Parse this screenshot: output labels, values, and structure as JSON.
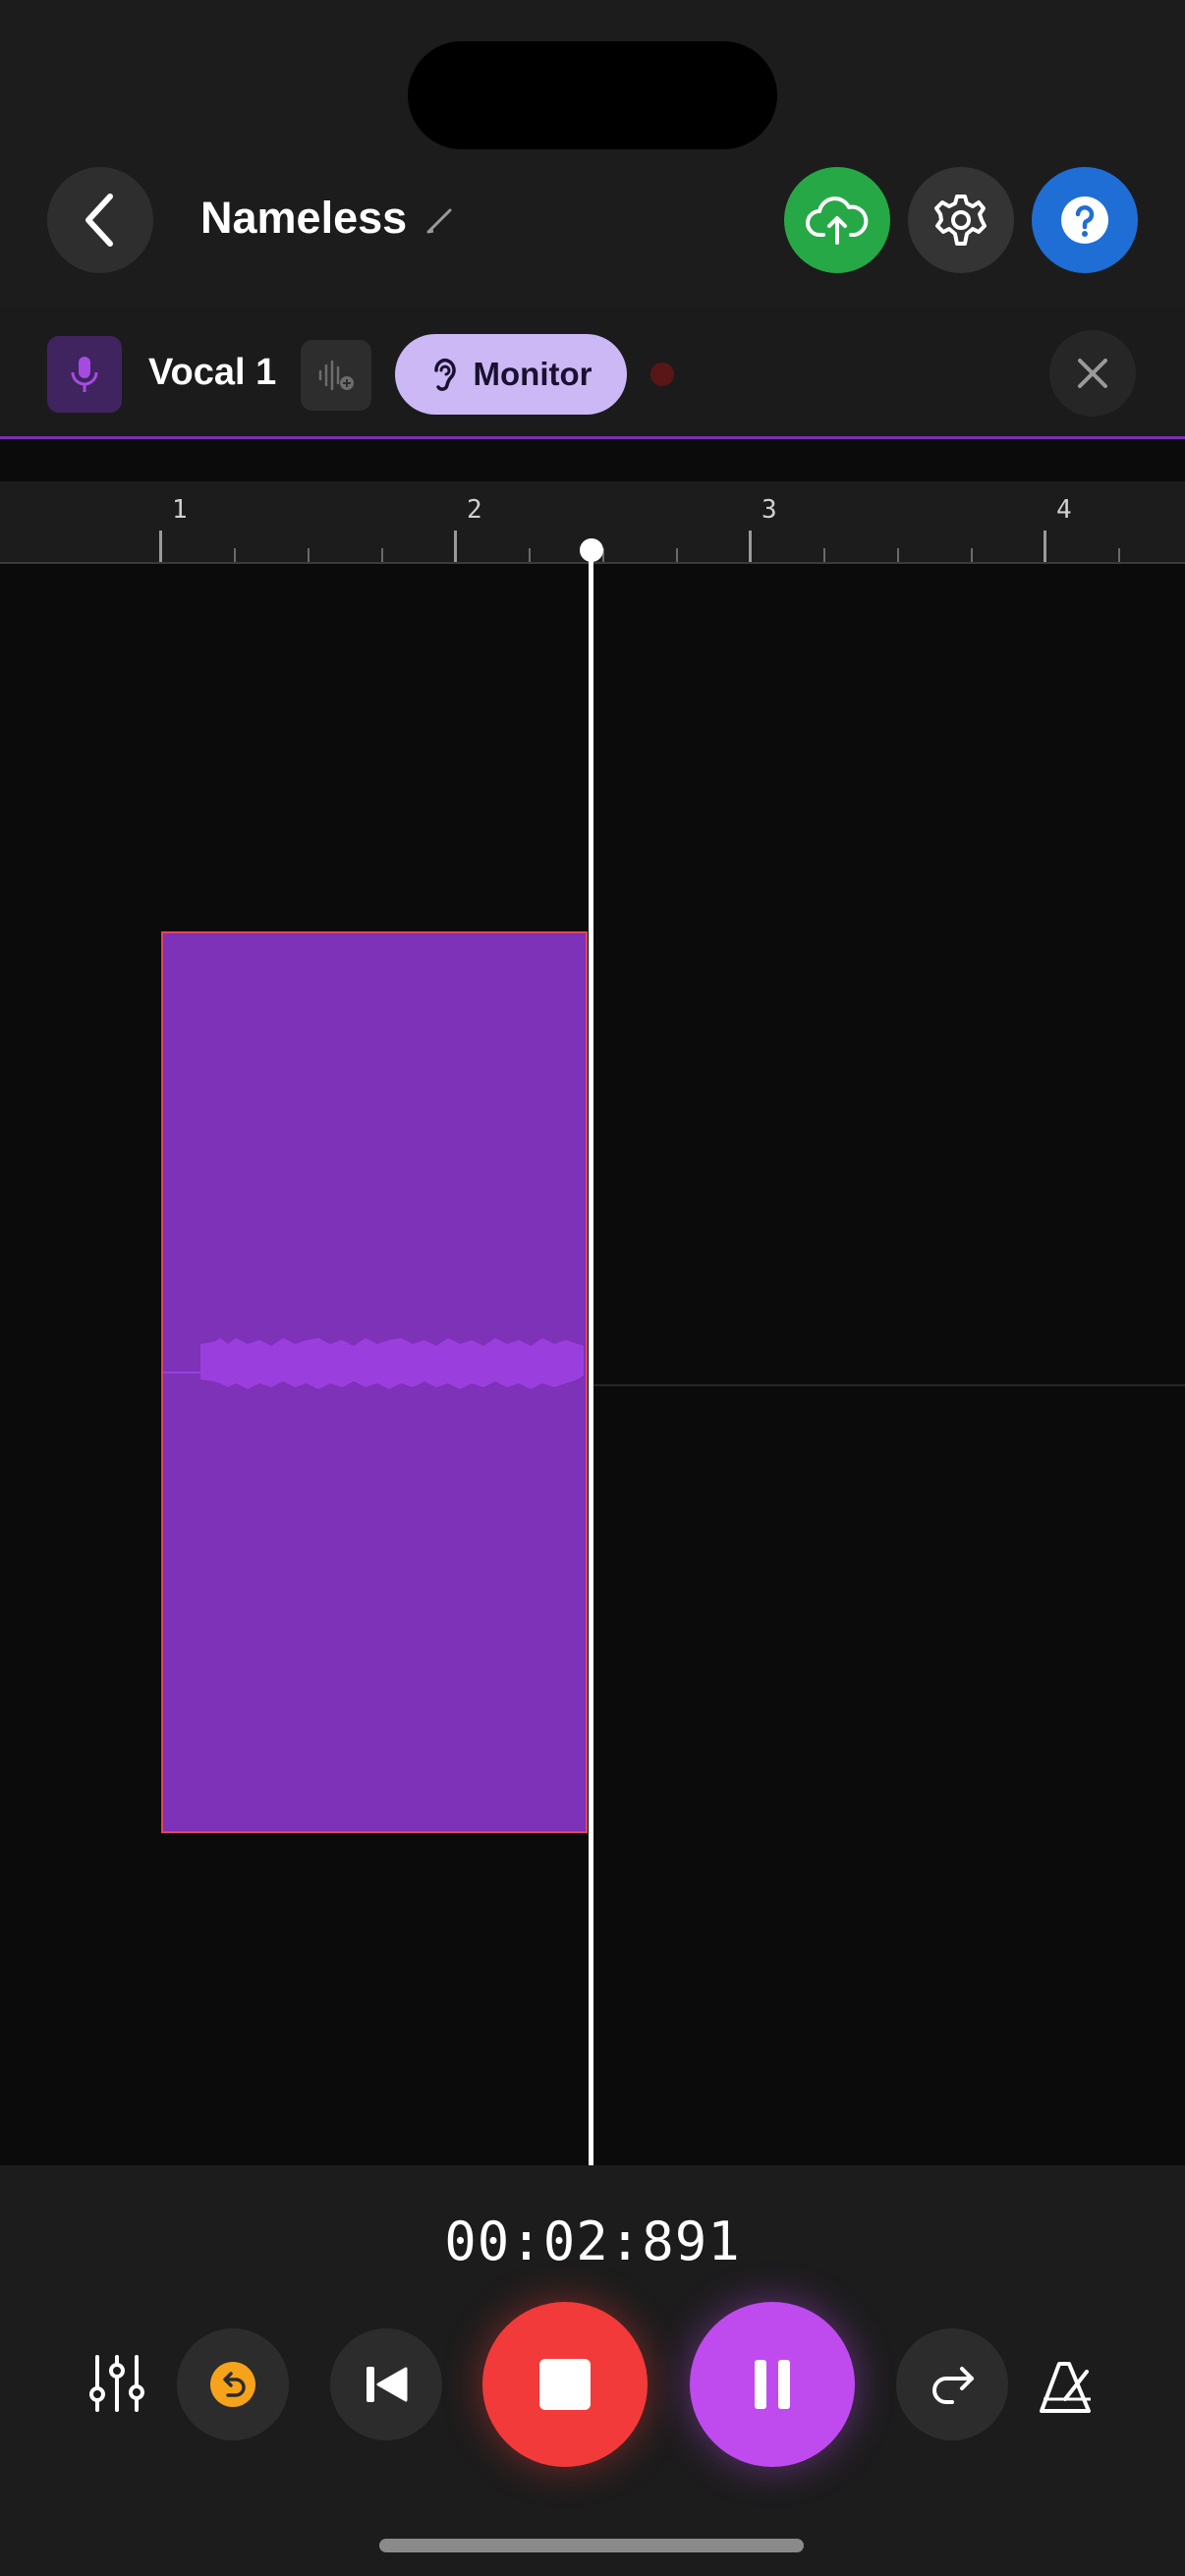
{
  "header": {
    "title": "Nameless",
    "back_icon": "chevron-left-icon",
    "edit_icon": "pencil-icon",
    "upload_icon": "cloud-upload-icon",
    "settings_icon": "gear-icon",
    "help_icon": "question-icon"
  },
  "track": {
    "name": "Vocal 1",
    "monitor_label": "Monitor",
    "icons": [
      "microphone-icon",
      "waveform-add-icon",
      "ear-icon",
      "close-icon"
    ]
  },
  "ruler": {
    "bars": [
      "1",
      "2",
      "3",
      "4"
    ]
  },
  "transport": {
    "timecode": "00:02:891",
    "icons": [
      "mixer-icon",
      "undo-icon",
      "rewind-icon",
      "stop-icon",
      "pause-icon",
      "redo-icon",
      "metronome-icon"
    ]
  },
  "colors": {
    "clip": "#7d32b8",
    "clip_border": "#e2455a",
    "record": "#f23a3a",
    "pause": "#bf4bef",
    "upload": "#27a846",
    "help": "#1f6ed6",
    "monitor": "#cbb8f5"
  }
}
